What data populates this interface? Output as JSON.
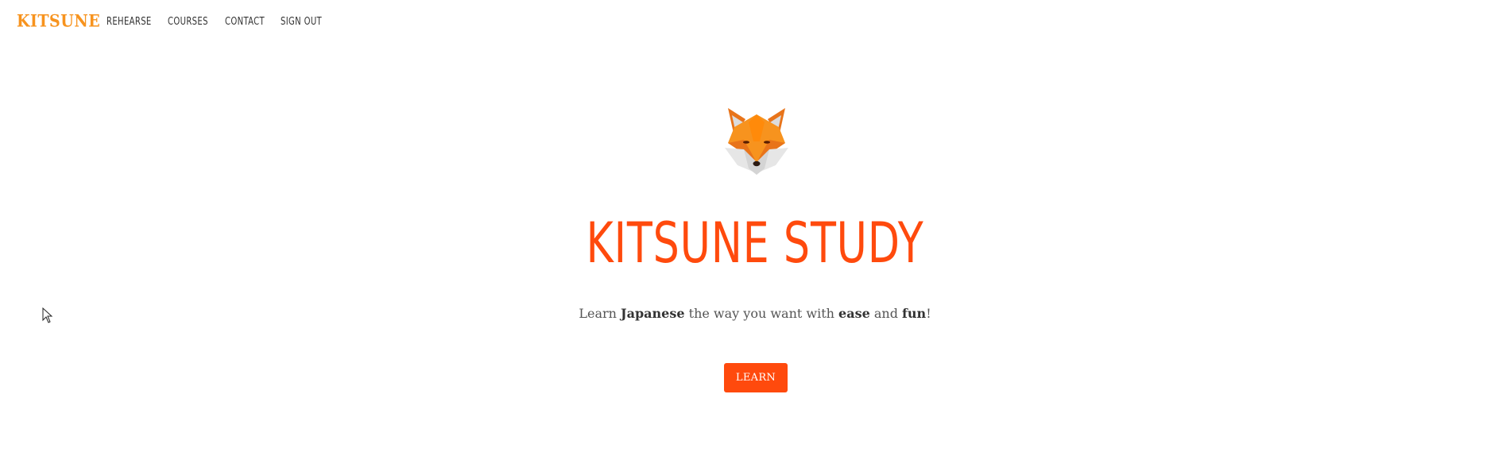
{
  "nav": {
    "brand": "KITSUNE",
    "links": [
      {
        "label": "REHEARSE"
      },
      {
        "label": "COURSES"
      },
      {
        "label": "CONTACT"
      },
      {
        "label": "SIGN OUT"
      }
    ]
  },
  "hero": {
    "logo_icon": "fox-head-icon",
    "title": "KITSUNE STUDY",
    "tagline": {
      "part1": "Learn ",
      "bold1": "Japanese",
      "part2": " the way you want with ",
      "bold2": "ease",
      "part3": " and ",
      "bold3": "fun",
      "part4": "!"
    },
    "button_label": "LEARN"
  },
  "colors": {
    "brand": "#f7931e",
    "accent": "#ff4a0d",
    "nav_text": "#333333",
    "body_text": "#555555"
  }
}
